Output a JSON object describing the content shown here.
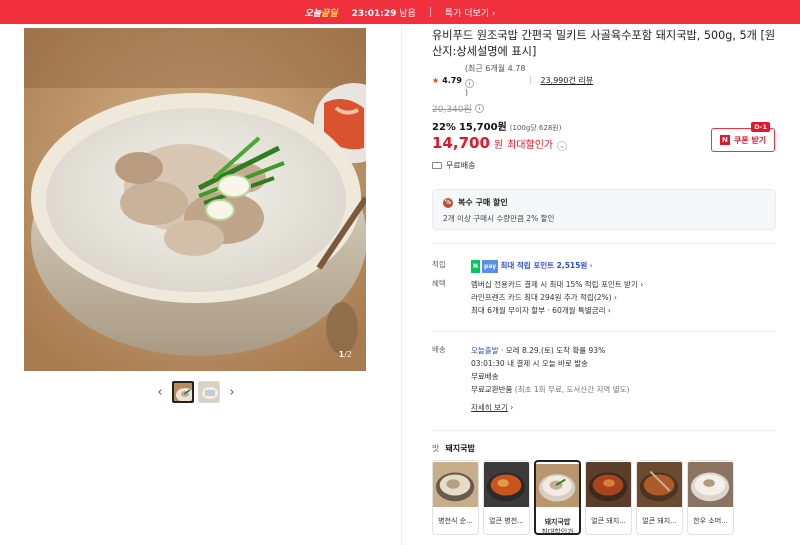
{
  "topbar": {
    "deal_prefix": "오늘",
    "deal_suffix": "끝딜",
    "timer": "23:01:29",
    "timer_suffix": "남음",
    "more": "특가 더보기",
    "more_arrow": "›"
  },
  "gallery": {
    "current": "1",
    "total": "/2",
    "prev": "‹",
    "next": "›"
  },
  "product": {
    "title": "유비푸드 원조국밥 간편국 밀키트 사골육수포함 돼지국밥, 500g, 5개 [원산지:상세설명에 표시]",
    "rating": "4.79",
    "rating_recent": "(최근 6개월 4.78",
    "rating_recent_close": ")",
    "reviews": "23,990건 리뷰",
    "original_price": "20,340원",
    "discount_pct": "22%",
    "discount_price": "15,700원",
    "unit_price": "(100g당 628원)",
    "final_price": "14,700",
    "final_won": "원",
    "final_label": "최대할인가",
    "coupon_label": "쿠폰 받기",
    "coupon_badge": "D-1",
    "coupon_icon": "N",
    "shipping": "무료배송"
  },
  "multi": {
    "title": "복수 구매 할인",
    "desc": "2개 이상 구매시 수량만큼 2% 할인",
    "icon": "%"
  },
  "benefits": {
    "points_key": "적립",
    "npay": "N",
    "pay": "pay",
    "points_text": "최대 적립 포인트 2,515원",
    "perks_key": "혜택",
    "perk1": "멤버십 전용카드 결제 시 최대 15% 적립 포인트 받기",
    "perk2": "라인프렌즈 카드 최대 294원 추가 적립(2%)",
    "perk3": "최대 6개월 무이자 할부 · 60개월 특별금리",
    "chevron": "›"
  },
  "delivery": {
    "key": "배송",
    "today_badge": "오늘출발",
    "today_text": "· 모레 8.29.(토) 도착 확률 93%",
    "today_time": "03:01:30  내 결제 시 오늘 바로 발송",
    "free": "무료배송",
    "return": "무료교환반품",
    "return_note": "(최초 1회 무료, 도서산간 지역 별도)",
    "detail": "자세히 보기",
    "detail_arrow": "›"
  },
  "options": {
    "key": "맛",
    "selected": "돼지국밥",
    "items": [
      {
        "label": "병천식 순...",
        "label2": ""
      },
      {
        "label": "얼큰 병천...",
        "label2": ""
      },
      {
        "label": "돼지국밥",
        "label2": "최대할인가"
      },
      {
        "label": "얼큰 돼지...",
        "label2": ""
      },
      {
        "label": "얼큰 돼지...",
        "label2": ""
      },
      {
        "label": "한우 소머...",
        "label2": ""
      }
    ]
  },
  "colors": {
    "accent": "#f0303d",
    "price_red": "#e4172a",
    "link_blue": "#2b4fd4"
  }
}
